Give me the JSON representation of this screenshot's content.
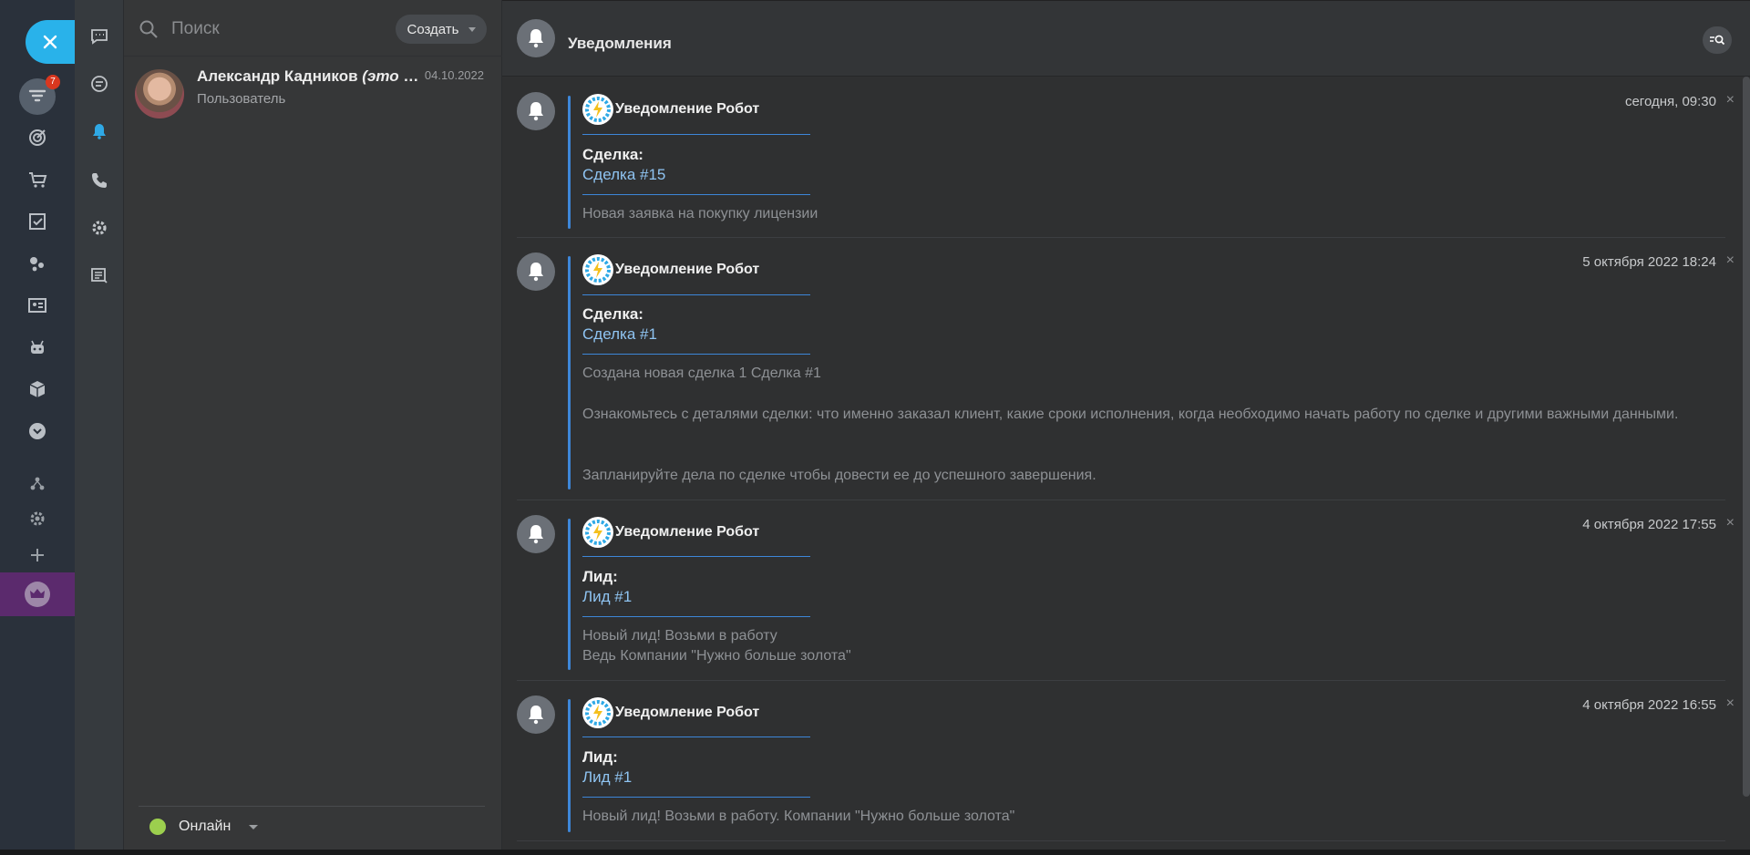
{
  "rail": {
    "badge_count": "7"
  },
  "list": {
    "search_placeholder": "Поиск",
    "create_label": "Создать",
    "contact": {
      "name": "Александр Кадников",
      "name_suffix": "(это в...",
      "date": "04.10.2022",
      "role": "Пользователь"
    },
    "status_label": "Онлайн"
  },
  "main": {
    "title": "Уведомления",
    "notifications": [
      {
        "sender": "Уведомление Робот",
        "time": "сегодня, 09:30",
        "field_label": "Сделка:",
        "field_link": "Сделка #15",
        "text": [
          "Новая заявка на покупку лицензии"
        ]
      },
      {
        "sender": "Уведомление Робот",
        "time": "5 октября 2022 18:24",
        "field_label": "Сделка:",
        "field_link": "Сделка #1",
        "text": [
          "Создана новая сделка 1 Сделка #1",
          "Ознакомьтесь с деталями сделки: что именно заказал клиент, какие сроки исполнения, когда необходимо начать работу по сделке и другими важными данными.",
          "Запланируйте дела по сделке чтобы довести ее до успешного завершения."
        ]
      },
      {
        "sender": "Уведомление Робот",
        "time": "4 октября 2022 17:55",
        "field_label": "Лид:",
        "field_link": "Лид #1",
        "text": [
          "Новый лид! Возьми в работу",
          "Ведь Компании \"Нужно больше золота\""
        ]
      },
      {
        "sender": "Уведомление Робот",
        "time": "4 октября 2022 16:55",
        "field_label": "Лид:",
        "field_link": "Лид #1",
        "text": [
          "Новый лид! Возьми в работу. Компании \"Нужно больше золота\""
        ]
      }
    ],
    "close_glyph": "×"
  }
}
